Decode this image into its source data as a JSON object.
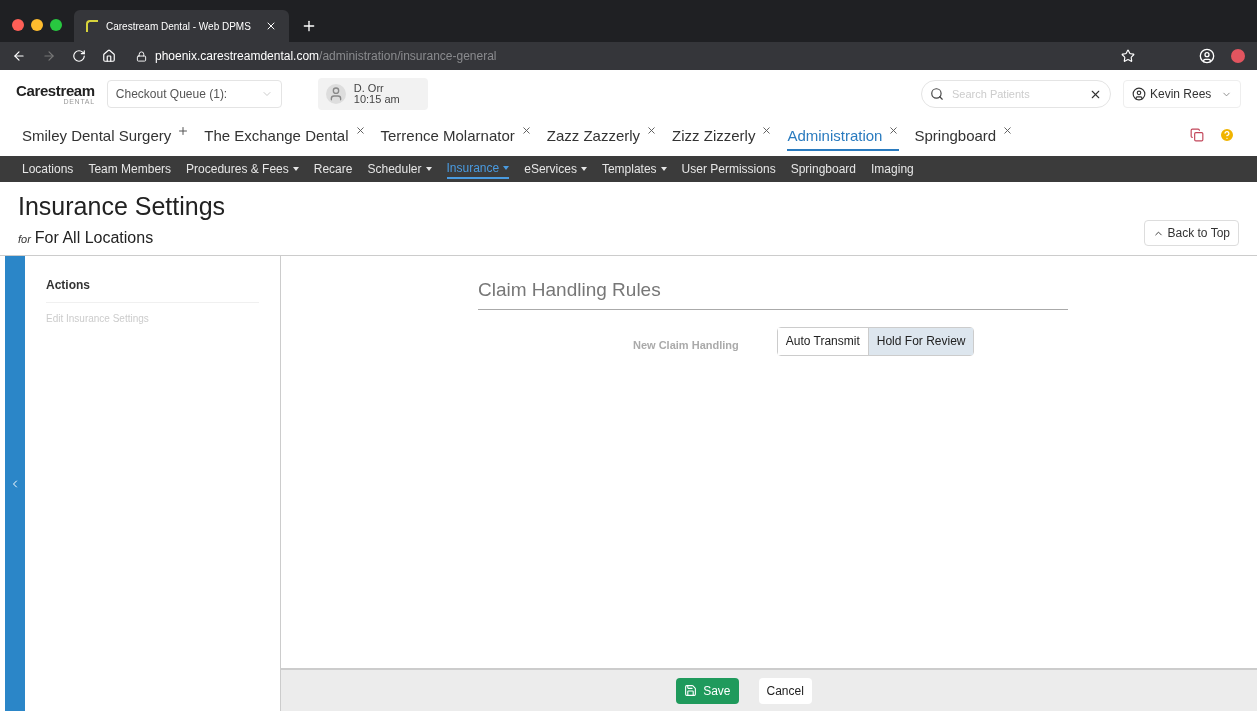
{
  "browser": {
    "tab_title": "Carestream Dental - Web DPMS",
    "url_host": "phoenix.carestreamdental.com",
    "url_path": "/administration/insurance-general"
  },
  "header": {
    "logo": "Carestream",
    "logo_sub": "DENTAL",
    "queue": "Checkout Queue (1):",
    "user_name": "D. Orr",
    "time": "10:15 am",
    "search_placeholder": "Search Patients",
    "account": "Kevin Rees"
  },
  "tabs": [
    {
      "label": "Smiley Dental Surgery",
      "kind": "add",
      "selected": false
    },
    {
      "label": "The Exchange Dental",
      "kind": "close",
      "selected": false
    },
    {
      "label": "Terrence Molarnator",
      "kind": "close",
      "selected": false
    },
    {
      "label": "Zazz Zazzerly",
      "kind": "close",
      "selected": false
    },
    {
      "label": "Zizz Zizzerly",
      "kind": "close",
      "selected": false
    },
    {
      "label": "Administration",
      "kind": "close",
      "selected": true
    },
    {
      "label": "Springboard",
      "kind": "close",
      "selected": false
    }
  ],
  "nav": [
    {
      "label": "Locations",
      "dropdown": false,
      "selected": false
    },
    {
      "label": "Team Members",
      "dropdown": false,
      "selected": false
    },
    {
      "label": "Procedures & Fees",
      "dropdown": true,
      "selected": false
    },
    {
      "label": "Recare",
      "dropdown": false,
      "selected": false
    },
    {
      "label": "Scheduler",
      "dropdown": true,
      "selected": false
    },
    {
      "label": "Insurance",
      "dropdown": true,
      "selected": true
    },
    {
      "label": "eServices",
      "dropdown": true,
      "selected": false
    },
    {
      "label": "Templates",
      "dropdown": true,
      "selected": false
    },
    {
      "label": "User Permissions",
      "dropdown": false,
      "selected": false
    },
    {
      "label": "Springboard",
      "dropdown": false,
      "selected": false
    },
    {
      "label": "Imaging",
      "dropdown": false,
      "selected": false
    }
  ],
  "page": {
    "title": "Insurance Settings",
    "for_prefix": "for",
    "for_text": "For All Locations",
    "back_to_top": "Back to Top"
  },
  "sidebar": {
    "heading": "Actions",
    "items": [
      {
        "label": "Edit Insurance Settings"
      }
    ]
  },
  "section": {
    "title": "Claim Handling Rules",
    "field_label": "New Claim Handling",
    "options": [
      {
        "label": "Auto Transmit",
        "selected": false
      },
      {
        "label": "Hold For Review",
        "selected": true
      }
    ]
  },
  "footer": {
    "save": "Save",
    "cancel": "Cancel"
  }
}
